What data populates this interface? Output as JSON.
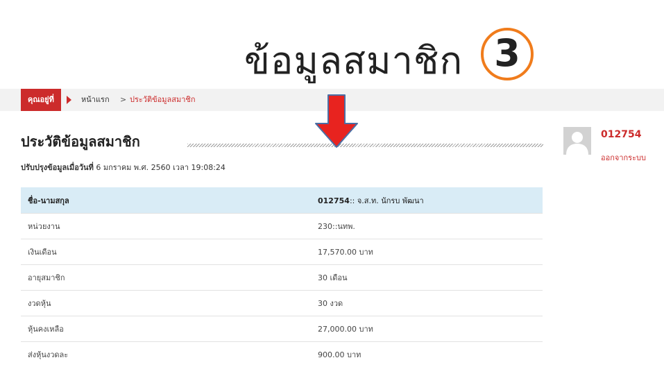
{
  "annotation": {
    "title": "ข้อมูลสมาชิก",
    "step_number": "3"
  },
  "breadcrumb": {
    "badge_label": "คุณอยู่ที่",
    "home": "หน้าแรก",
    "separator": ">",
    "current": "ประวัติข้อมูลสมาชิก"
  },
  "page": {
    "title": "ประวัติข้อมูลสมาชิก",
    "updated_label": "ปรับปรุงข้อมูลเมื่อวันที่",
    "updated_value": "6 มกราคม พ.ศ. 2560 เวลา 19:08:24"
  },
  "table": {
    "header": {
      "label": "ชื่อ-นามสกุล",
      "value_id": "012754",
      "value_rest": ":: จ.ส.ท. นักรบ พัฒนา"
    },
    "rows": [
      {
        "label": "หน่วยงาน",
        "value": "230::นทพ."
      },
      {
        "label": "เงินเดือน",
        "value": "17,570.00 บาท"
      },
      {
        "label": "อายุสมาชิก",
        "value": "30 เดือน"
      },
      {
        "label": "งวดหุ้น",
        "value": "30 งวด"
      },
      {
        "label": "หุ้นคงเหลือ",
        "value": "27,000.00 บาท"
      },
      {
        "label": "ส่งหุ้นงวดละ",
        "value": "900.00 บาท"
      }
    ]
  },
  "user": {
    "id": "012754",
    "logout_label": "ออกจากระบบ"
  },
  "colors": {
    "accent_red": "#cc2b2b",
    "header_blue": "#d9ecf6",
    "circle_orange": "#f07c1c",
    "arrow_red": "#e8231f",
    "arrow_outline": "#4a6fa5"
  },
  "icons": {
    "avatar": "user-silhouette-icon",
    "annotation_arrow": "down-arrow-icon"
  }
}
